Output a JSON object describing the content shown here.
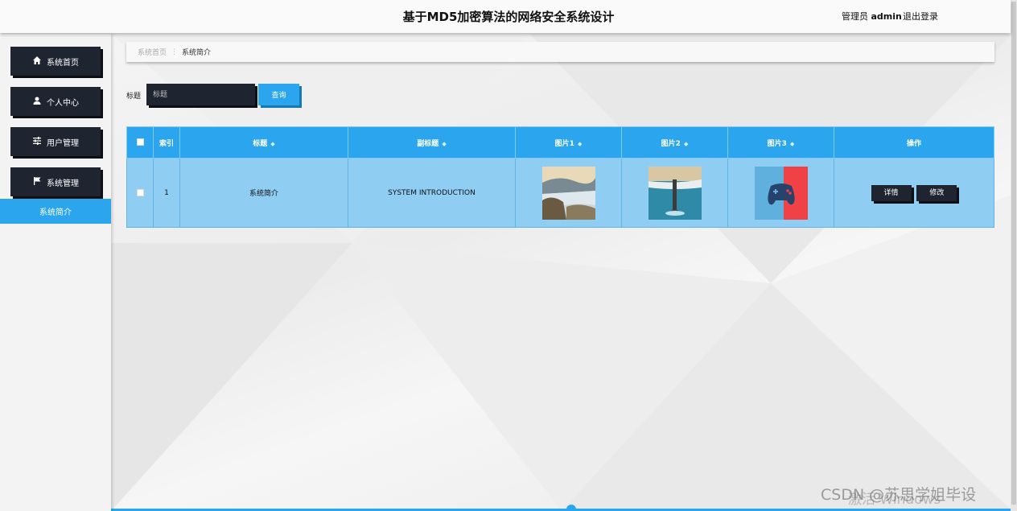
{
  "header": {
    "title": "基于MD5加密算法的网络安全系统设计",
    "user_label": "管理员",
    "username": "admin",
    "logout": "退出登录"
  },
  "sidebar": {
    "items": [
      {
        "label": "系统首页",
        "icon": "home-icon"
      },
      {
        "label": "个人中心",
        "icon": "user-icon"
      },
      {
        "label": "用户管理",
        "icon": "sliders-icon"
      },
      {
        "label": "系统管理",
        "icon": "flag-icon"
      }
    ],
    "active_sub": "系统简介"
  },
  "breadcrumb": {
    "home": "系统首页",
    "separator": "⋮",
    "current": "系统简介"
  },
  "search": {
    "label": "标题",
    "placeholder": "标题",
    "button": "查询"
  },
  "table": {
    "headers": [
      "索引",
      "标题",
      "副标题",
      "图片1",
      "图片2",
      "图片3",
      "操作"
    ],
    "rows": [
      {
        "index": "1",
        "title": "系统简介",
        "subtitle": "SYSTEM INTRODUCTION"
      }
    ],
    "actions": {
      "detail": "详情",
      "edit": "修改"
    }
  },
  "overlay": {
    "activate": "激活 Windows",
    "csdn": "CSDN @苏思学姐毕设"
  },
  "colors": {
    "accent": "#2ba6ee",
    "dark": "#1f2530",
    "row": "#8fcdf3"
  }
}
